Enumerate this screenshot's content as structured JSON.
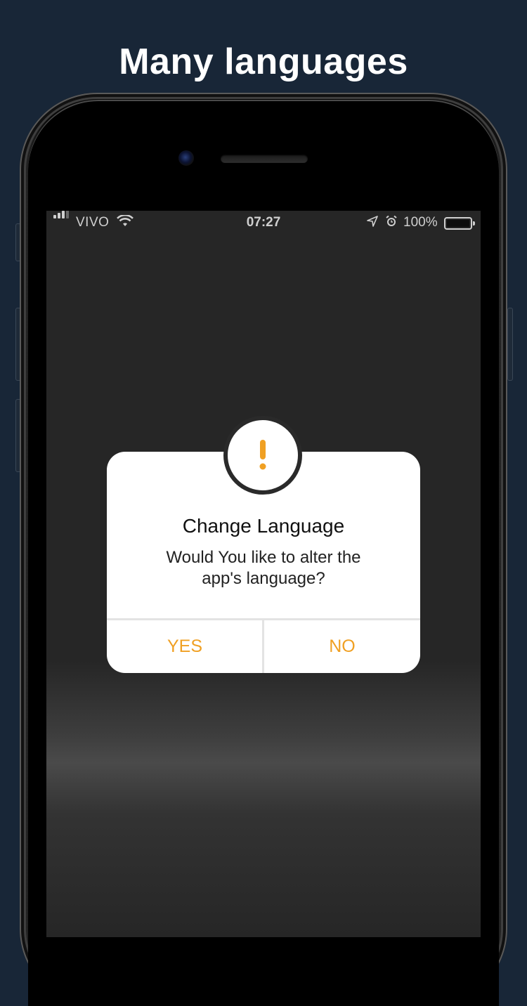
{
  "headline": "Many languages",
  "statusbar": {
    "carrier": "VIVO",
    "time": "07:27",
    "battery": "100%"
  },
  "dialog": {
    "title": "Change Language",
    "message": "Would You like to alter the app's language?",
    "yes_label": "YES",
    "no_label": "NO",
    "icon": "exclamation-icon"
  },
  "colors": {
    "background": "#182637",
    "accent": "#f0a023",
    "screen": "#262626"
  }
}
